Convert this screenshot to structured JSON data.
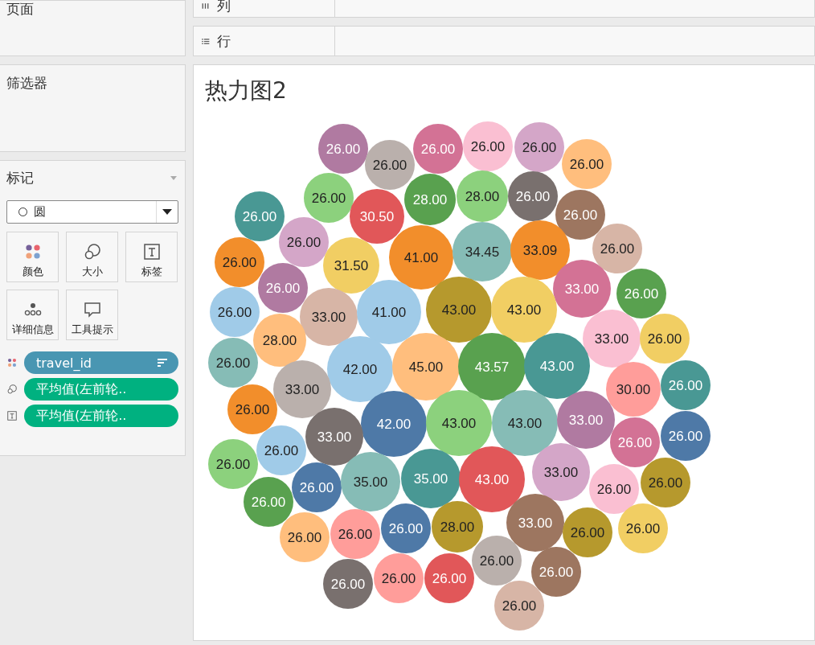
{
  "pages_section": {
    "title": "页面"
  },
  "shelves": [
    {
      "kind": "columns",
      "label": "列"
    },
    {
      "kind": "rows",
      "label": "行"
    }
  ],
  "filters_section": {
    "title": "筛选器"
  },
  "marks_card": {
    "title": "标记",
    "mark_type": "圆",
    "buttons": [
      {
        "kind": "color",
        "label": "颜色"
      },
      {
        "kind": "size",
        "label": "大小"
      },
      {
        "kind": "label",
        "label": "标签"
      },
      {
        "kind": "detail",
        "label": "详细信息"
      },
      {
        "kind": "tooltip",
        "label": "工具提示"
      }
    ],
    "pills": [
      {
        "kind": "color",
        "text": "travel_id",
        "color": "#4996b2",
        "sorted": true
      },
      {
        "kind": "size",
        "text": "平均值(左前轮..",
        "color": "#00b180",
        "sorted": false
      },
      {
        "kind": "label",
        "text": "平均值(左前轮..",
        "color": "#00b180",
        "sorted": false
      }
    ]
  },
  "viz": {
    "title": "热力图2",
    "bubbles": [
      {
        "label": "26.00",
        "color": "#b07aa1"
      },
      {
        "label": "26.00",
        "color": "#d37295"
      },
      {
        "label": "26.00",
        "color": "#fabfd2"
      },
      {
        "label": "26.00",
        "color": "#d4a6c8"
      },
      {
        "label": "26.00",
        "color": "#bab0ac"
      },
      {
        "label": "26.00",
        "color": "#ffbe7d"
      },
      {
        "label": "26.00",
        "color": "#8cd17d"
      },
      {
        "label": "28.00",
        "color": "#59a14f"
      },
      {
        "label": "28.00",
        "color": "#8cd17d"
      },
      {
        "label": "26.00",
        "color": "#79706e"
      },
      {
        "label": "26.00",
        "color": "#499894"
      },
      {
        "label": "30.50",
        "color": "#e15759"
      },
      {
        "label": "26.00",
        "color": "#9d7660"
      },
      {
        "label": "26.00",
        "color": "#f28e2b"
      },
      {
        "label": "26.00",
        "color": "#d4a6c8"
      },
      {
        "label": "31.50",
        "color": "#f1ce63"
      },
      {
        "label": "41.00",
        "color": "#f28e2b"
      },
      {
        "label": "34.45",
        "color": "#86bcb6"
      },
      {
        "label": "33.09",
        "color": "#f28e2b"
      },
      {
        "label": "26.00",
        "color": "#d7b5a6"
      },
      {
        "label": "26.00",
        "color": "#b07aa1"
      },
      {
        "label": "33.00",
        "color": "#d37295"
      },
      {
        "label": "26.00",
        "color": "#59a14f"
      },
      {
        "label": "26.00",
        "color": "#a0cbe8"
      },
      {
        "label": "33.00",
        "color": "#d7b5a6"
      },
      {
        "label": "41.00",
        "color": "#a0cbe8"
      },
      {
        "label": "43.00",
        "color": "#b6992d"
      },
      {
        "label": "43.00",
        "color": "#f1ce63"
      },
      {
        "label": "28.00",
        "color": "#ffbe7d"
      },
      {
        "label": "33.00",
        "color": "#fabfd2"
      },
      {
        "label": "26.00",
        "color": "#f1ce63"
      },
      {
        "label": "26.00",
        "color": "#86bcb6"
      },
      {
        "label": "42.00",
        "color": "#a0cbe8"
      },
      {
        "label": "45.00",
        "color": "#ffbe7d"
      },
      {
        "label": "43.57",
        "color": "#59a14f"
      },
      {
        "label": "43.00",
        "color": "#499894"
      },
      {
        "label": "33.00",
        "color": "#bab0ac"
      },
      {
        "label": "30.00",
        "color": "#ff9d9a"
      },
      {
        "label": "26.00",
        "color": "#499894"
      },
      {
        "label": "26.00",
        "color": "#f28e2b"
      },
      {
        "label": "42.00",
        "color": "#4e79a7"
      },
      {
        "label": "43.00",
        "color": "#8cd17d"
      },
      {
        "label": "43.00",
        "color": "#86bcb6"
      },
      {
        "label": "33.00",
        "color": "#b07aa1"
      },
      {
        "label": "33.00",
        "color": "#79706e"
      },
      {
        "label": "26.00",
        "color": "#d37295"
      },
      {
        "label": "26.00",
        "color": "#4e79a7"
      },
      {
        "label": "26.00",
        "color": "#a0cbe8"
      },
      {
        "label": "26.00",
        "color": "#8cd17d"
      },
      {
        "label": "26.00",
        "color": "#4e79a7"
      },
      {
        "label": "35.00",
        "color": "#86bcb6"
      },
      {
        "label": "35.00",
        "color": "#499894"
      },
      {
        "label": "43.00",
        "color": "#e15759"
      },
      {
        "label": "33.00",
        "color": "#d4a6c8"
      },
      {
        "label": "26.00",
        "color": "#fabfd2"
      },
      {
        "label": "26.00",
        "color": "#b6992d"
      },
      {
        "label": "26.00",
        "color": "#59a14f"
      },
      {
        "label": "26.00",
        "color": "#ffbe7d"
      },
      {
        "label": "26.00",
        "color": "#ff9d9a"
      },
      {
        "label": "26.00",
        "color": "#4e79a7"
      },
      {
        "label": "28.00",
        "color": "#b6992d"
      },
      {
        "label": "33.00",
        "color": "#9d7660"
      },
      {
        "label": "26.00",
        "color": "#b6992d"
      },
      {
        "label": "26.00",
        "color": "#f1ce63"
      },
      {
        "label": "26.00",
        "color": "#bab0ac"
      },
      {
        "label": "26.00",
        "color": "#79706e"
      },
      {
        "label": "26.00",
        "color": "#ff9d9a"
      },
      {
        "label": "26.00",
        "color": "#e15759"
      },
      {
        "label": "26.00",
        "color": "#9d7660"
      },
      {
        "label": "26.00",
        "color": "#d7b5a6"
      }
    ]
  }
}
